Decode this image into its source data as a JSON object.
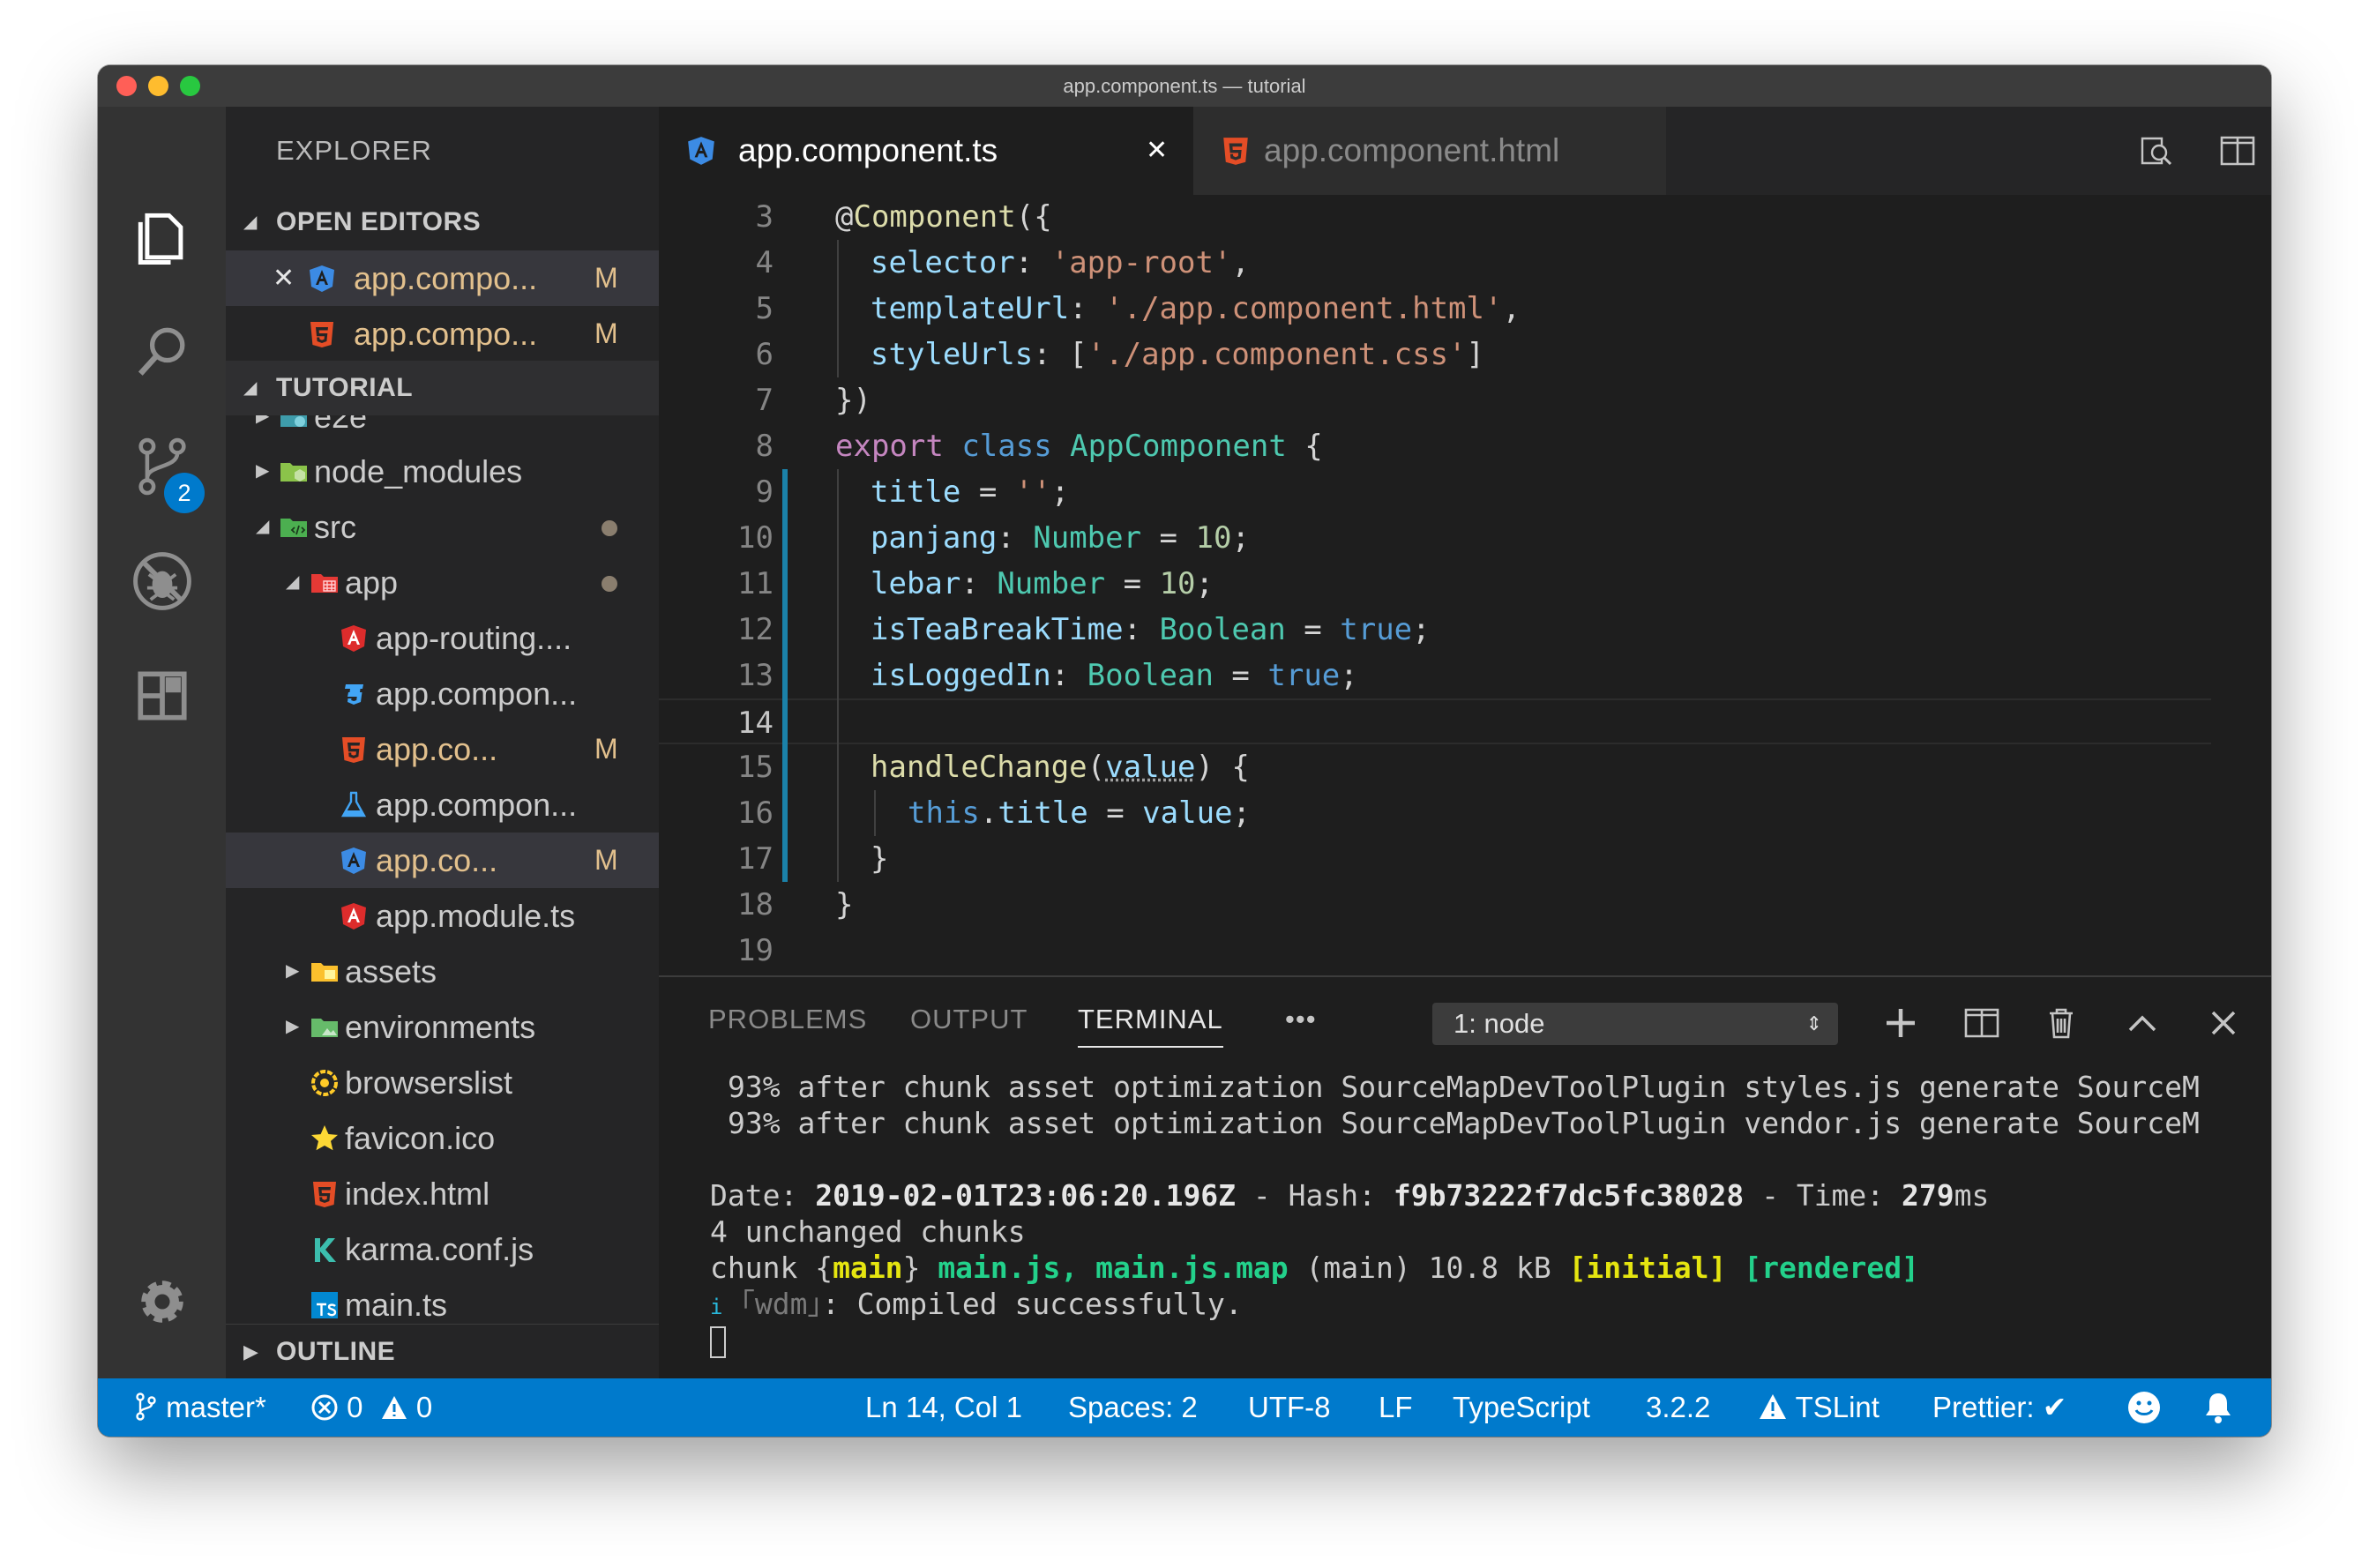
{
  "window": {
    "title": "app.component.ts — tutorial"
  },
  "activity_bar": {
    "scm_badge": "2"
  },
  "sidebar": {
    "title": "EXPLORER",
    "open_editors_header": "OPEN EDITORS",
    "open_editors": [
      {
        "label": "app.compo...",
        "status": "M",
        "icon": "angular-ts-icon"
      },
      {
        "label": "app.compo...",
        "status": "M",
        "icon": "html5-icon"
      }
    ],
    "tutorial_header": "TUTORIAL",
    "tree": [
      {
        "label": "e2e",
        "icon": "folder-e2e-icon"
      },
      {
        "label": "node_modules",
        "icon": "folder-node-icon"
      },
      {
        "label": "src",
        "icon": "folder-src-icon"
      },
      {
        "label": "app",
        "icon": "folder-app-icon"
      },
      {
        "label": "app-routing....",
        "icon": "angular-icon"
      },
      {
        "label": "app.compon...",
        "icon": "css3-icon"
      },
      {
        "label": "app.co...",
        "status": "M",
        "icon": "html5-icon"
      },
      {
        "label": "app.compon...",
        "icon": "test-flask-icon"
      },
      {
        "label": "app.co...",
        "status": "M",
        "icon": "angular-ts-icon"
      },
      {
        "label": "app.module.ts",
        "icon": "angular-icon"
      },
      {
        "label": "assets",
        "icon": "folder-assets-icon"
      },
      {
        "label": "environments",
        "icon": "folder-env-icon"
      },
      {
        "label": "browserslist",
        "icon": "browserslist-icon"
      },
      {
        "label": "favicon.ico",
        "icon": "star-icon"
      },
      {
        "label": "index.html",
        "icon": "html5-icon"
      },
      {
        "label": "karma.conf.js",
        "icon": "karma-icon"
      },
      {
        "label": "main.ts",
        "icon": "typescript-icon"
      }
    ],
    "outline_header": "OUTLINE"
  },
  "tabs": [
    {
      "label": "app.component.ts",
      "active": true,
      "icon": "angular-ts-icon"
    },
    {
      "label": "app.component.html",
      "active": false,
      "icon": "html5-icon"
    }
  ],
  "editor": {
    "line_numbers": [
      "3",
      "4",
      "5",
      "6",
      "7",
      "8",
      "9",
      "10",
      "11",
      "12",
      "13",
      "14",
      "15",
      "16",
      "17",
      "18",
      "19"
    ],
    "tokens": {
      "decorator_at": "@",
      "component": "Component",
      "open_paren_brace": "({",
      "selector_key": "selector",
      "selector_val": "'app-root'",
      "template_key": "templateUrl",
      "template_val": "'./app.component.html'",
      "style_key": "styleUrls",
      "style_val": "'./app.component.css'",
      "close_brace_paren": "})",
      "export": "export",
      "class": "class",
      "class_name": "AppComponent",
      "title_key": "title",
      "title_val": "''",
      "panjang": "panjang",
      "lebar": "lebar",
      "number_type": "Number",
      "num_10": "10",
      "is_tea": "isTeaBreakTime",
      "is_logged": "isLoggedIn",
      "boolean_type": "Boolean",
      "true_kw": "true",
      "handle": "handleChange",
      "value_param": "value",
      "this_kw": "this",
      "title_prop": "title"
    }
  },
  "panel": {
    "tabs": [
      "PROBLEMS",
      "OUTPUT",
      "TERMINAL"
    ],
    "active_tab": "TERMINAL",
    "more": "•••",
    "terminal_select": "1: node",
    "terminal": {
      "line1": "93% after chunk asset optimization SourceMapDevToolPlugin styles.js generate SourceM",
      "line2": "93% after chunk asset optimization SourceMapDevToolPlugin vendor.js generate SourceM",
      "date_label": "Date: ",
      "date_value": "2019-02-01T23:06:20.196Z",
      "hash_label": " - Hash: ",
      "hash_value": "f9b73222f7dc5fc38028",
      "time_label": " - Time: ",
      "time_value": "279",
      "time_unit": "ms",
      "unchanged": "4 unchanged chunks",
      "chunk_label": "chunk {",
      "chunk_name": "main",
      "chunk_close": "} ",
      "chunk_files": "main.js, main.js.map",
      "chunk_info": " (main) 10.8 kB ",
      "initial": "[initial]",
      "rendered": "[rendered]",
      "info_icon": "i",
      "wdm": "｢wdm｣",
      "compiled": ": Compiled successfully."
    }
  },
  "status_bar": {
    "branch": "master*",
    "errors": "0",
    "warnings": "0",
    "position": "Ln 14, Col 1",
    "spaces": "Spaces: 2",
    "encoding": "UTF-8",
    "eol": "LF",
    "language": "TypeScript",
    "ts_version": "3.2.2",
    "tslint": "TSLint",
    "prettier": "Prettier:",
    "colors": {
      "background": "#007acc"
    }
  },
  "colors": {
    "accent": "#007acc",
    "modified": "#e2c08d",
    "editor_bg": "#1e1e1e"
  }
}
